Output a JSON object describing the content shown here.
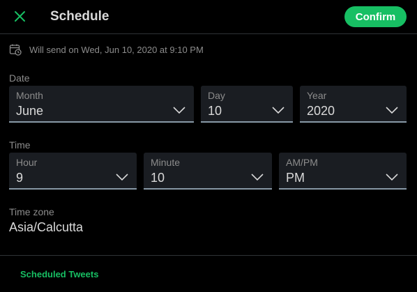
{
  "header": {
    "title": "Schedule",
    "confirm_label": "Confirm"
  },
  "will_send": {
    "text": "Will send on Wed, Jun 10, 2020 at 9:10 PM"
  },
  "date": {
    "section_label": "Date",
    "month": {
      "label": "Month",
      "value": "June"
    },
    "day": {
      "label": "Day",
      "value": "10"
    },
    "year": {
      "label": "Year",
      "value": "2020"
    }
  },
  "time": {
    "section_label": "Time",
    "hour": {
      "label": "Hour",
      "value": "9"
    },
    "minute": {
      "label": "Minute",
      "value": "10"
    },
    "ampm": {
      "label": "AM/PM",
      "value": "PM"
    }
  },
  "timezone": {
    "label": "Time zone",
    "value": "Asia/Calcutta"
  },
  "footer": {
    "scheduled_tweets_label": "Scheduled Tweets"
  },
  "colors": {
    "accent": "#17bf63",
    "background": "#000000",
    "field_bg": "#1a1d22",
    "muted_text": "#8c8c8c"
  },
  "icons": [
    "close-icon",
    "calendar-clock-icon",
    "chevron-down-icon"
  ]
}
